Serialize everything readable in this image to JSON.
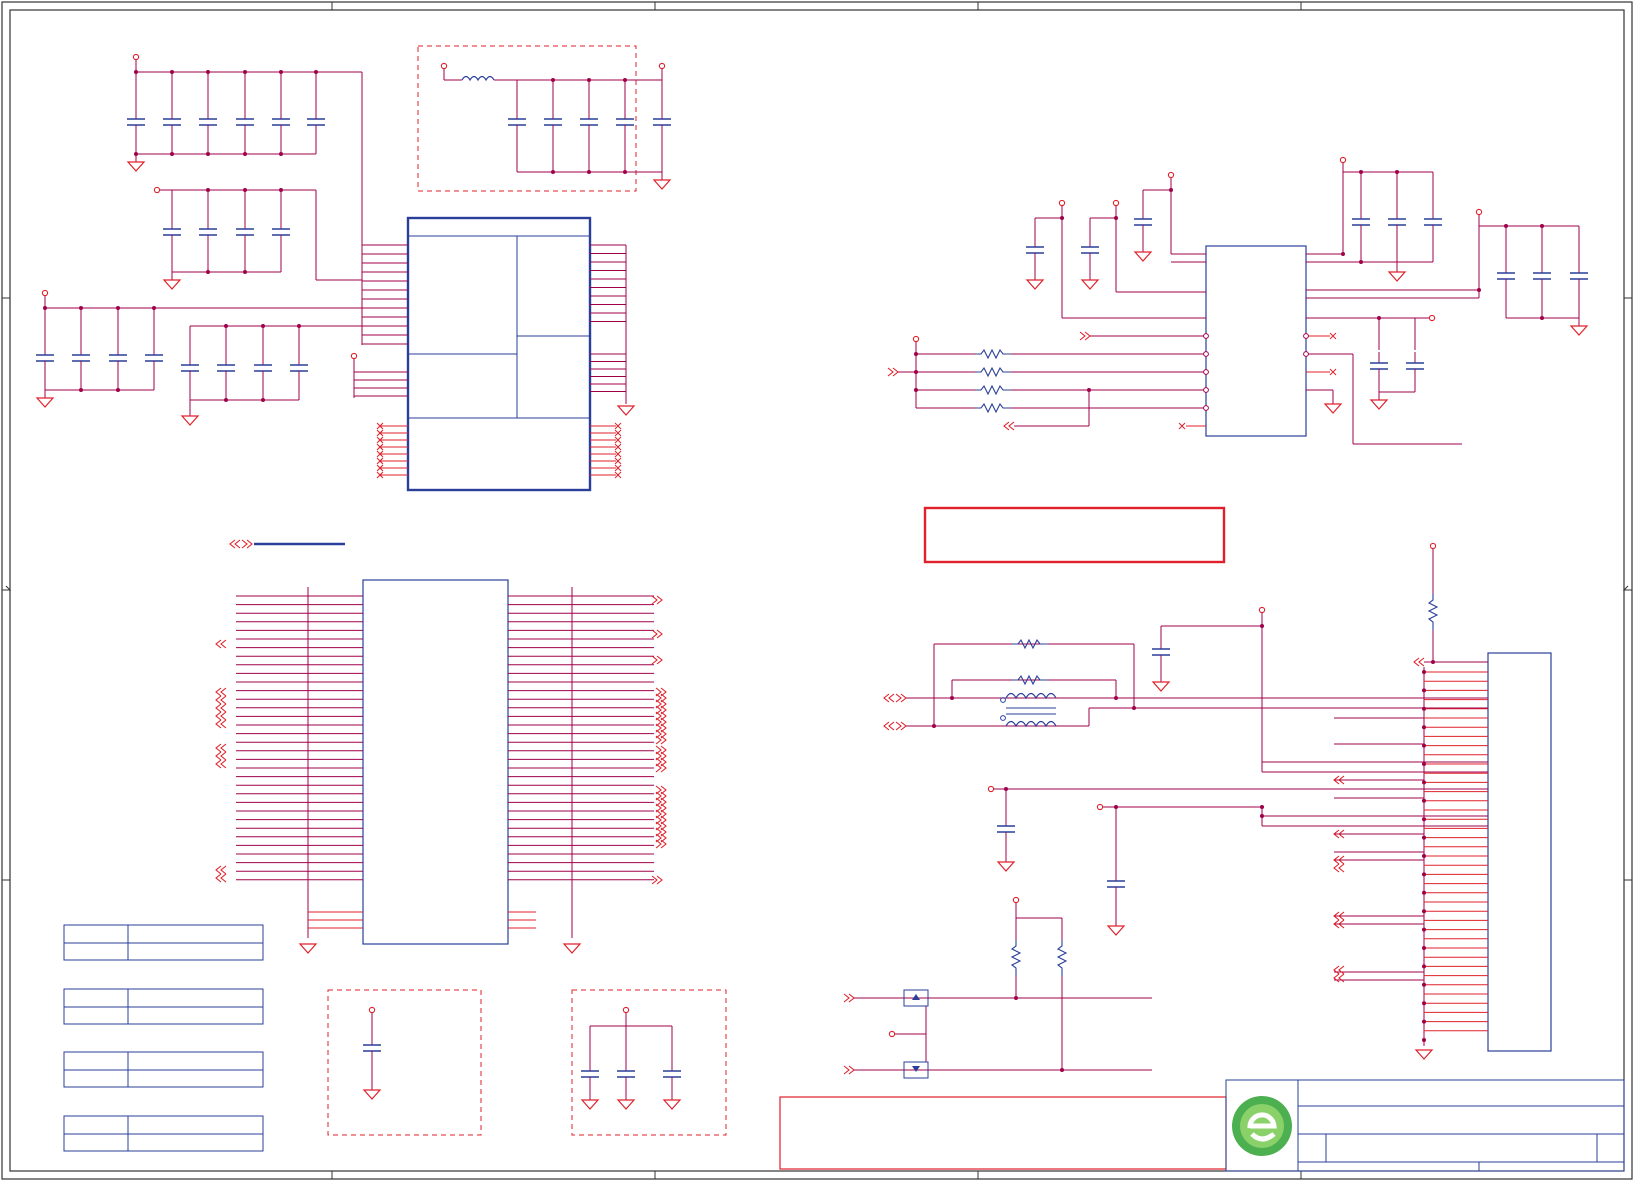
{
  "sheet": {
    "palette": {
      "wire": "#a0004a",
      "part": "#e0202a",
      "outline": "#2a3f9a",
      "highlight": "#e0202a",
      "frame": "#333333",
      "logo_green": "#4caf50"
    },
    "symbols": [
      "capacitor",
      "resistor",
      "inductor",
      "ground",
      "power-pin",
      "mosfet",
      "connector"
    ],
    "title_block": {
      "logo": "company-logo-icon"
    }
  }
}
